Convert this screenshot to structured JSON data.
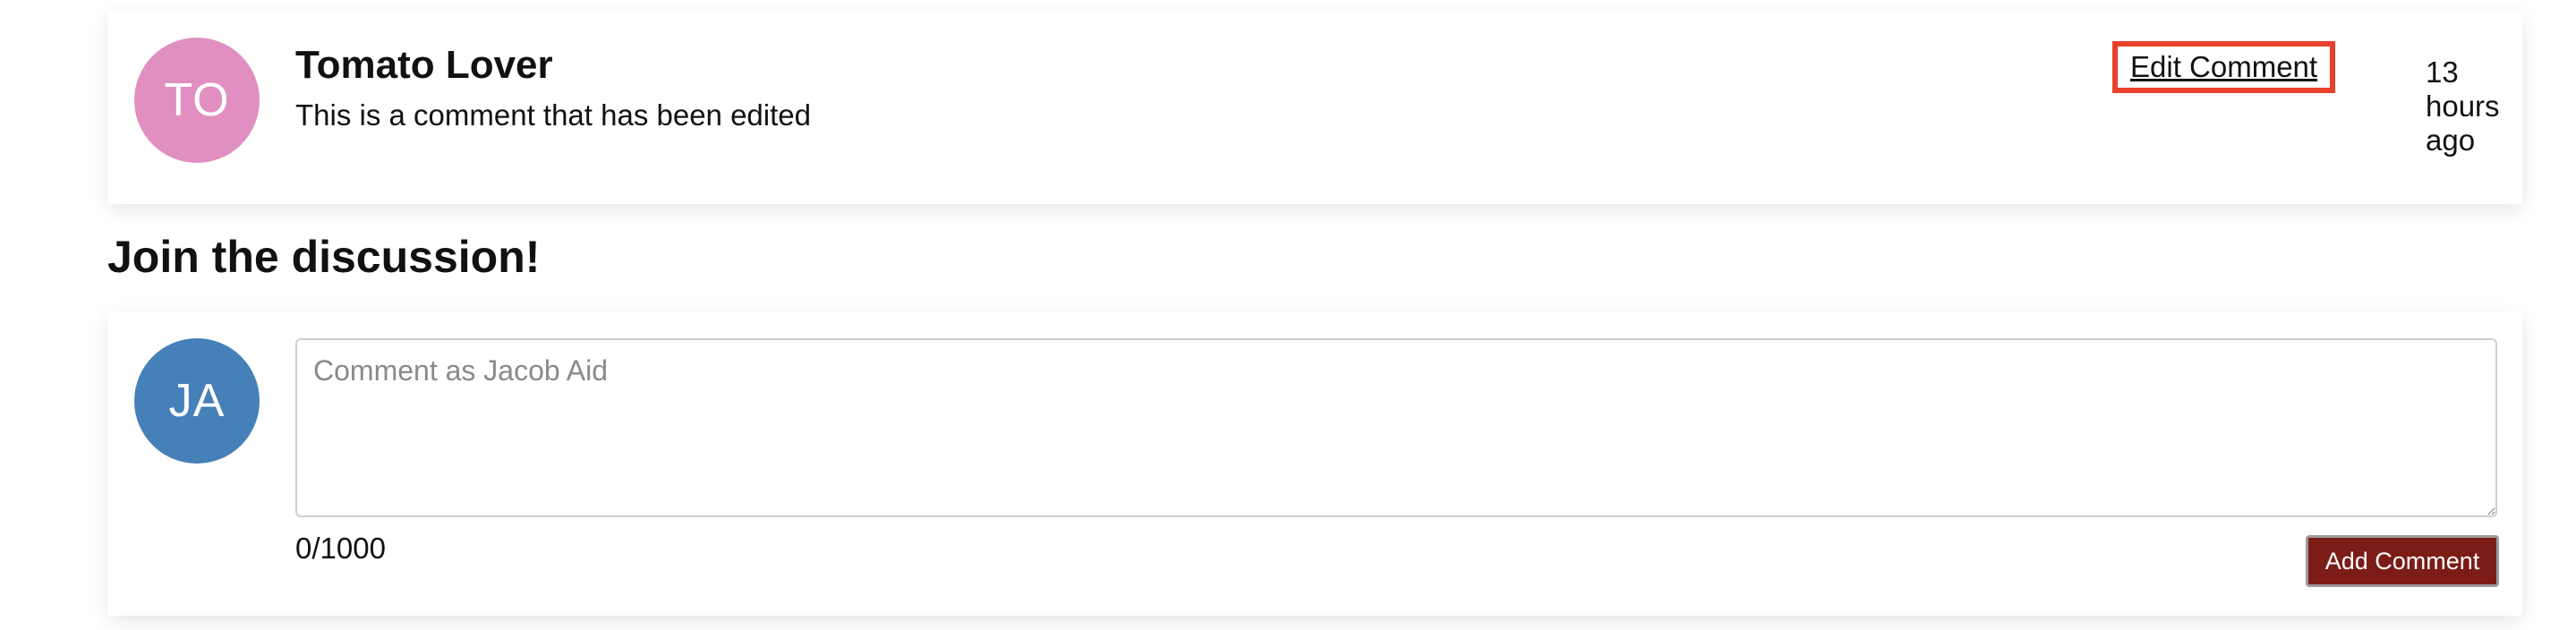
{
  "existing_comment": {
    "avatar_initials": "TO",
    "avatar_color": "#e08fc0",
    "author": "Tomato Lover",
    "text": "This is a comment that has been edited",
    "edit_label": "Edit Comment",
    "timestamp": "13 hours ago",
    "highlight_color": "#e8402a"
  },
  "discussion": {
    "heading": "Join the discussion!",
    "avatar_initials": "JA",
    "avatar_color": "#4680b8",
    "input_placeholder": "Comment as Jacob Aid",
    "char_count": "0/1000",
    "add_label": "Add Comment",
    "add_button_color": "#7b1c17"
  }
}
